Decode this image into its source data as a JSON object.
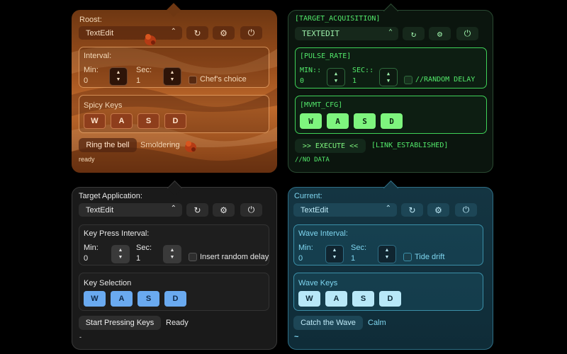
{
  "panels": {
    "roost": {
      "title": "Roost:",
      "app": "TextEdit",
      "interval_label": "Interval:",
      "min_label": "Min:",
      "min_value": "0",
      "sec_label": "Sec:",
      "sec_value": "1",
      "random_label": "Chef's choice",
      "keys_label": "Spicy Keys",
      "keys": [
        "W",
        "A",
        "S",
        "D"
      ],
      "start_label": "Ring the bell",
      "status": "Smoldering",
      "footer": "ready"
    },
    "terminal": {
      "title": "[TARGET_ACQUISITION]",
      "app": "TEXTEDIT",
      "interval_label": "[PULSE_RATE]",
      "min_label": "MIN::",
      "min_value": "0",
      "sec_label": "SEC::",
      "sec_value": "1",
      "random_label": "//RANDOM DELAY",
      "keys_label": "[MVMT_CFG]",
      "keys": [
        "W",
        "A",
        "S",
        "D"
      ],
      "start_label": ">> EXECUTE <<",
      "status": "[LINK_ESTABLISHED]",
      "footer": "//NO DATA"
    },
    "standard": {
      "title": "Target Application:",
      "app": "TextEdit",
      "interval_label": "Key Press Interval:",
      "min_label": "Min:",
      "min_value": "0",
      "sec_label": "Sec:",
      "sec_value": "1",
      "random_label": "Insert random delay",
      "keys_label": "Key Selection",
      "keys": [
        "W",
        "A",
        "S",
        "D"
      ],
      "start_label": "Start Pressing Keys",
      "status": "Ready",
      "footer": "-"
    },
    "ocean": {
      "title": "Current:",
      "app": "TextEdit",
      "interval_label": "Wave Interval:",
      "min_label": "Min:",
      "min_value": "0",
      "sec_label": "Sec:",
      "sec_value": "1",
      "random_label": "Tide drift",
      "keys_label": "Wave Keys",
      "keys": [
        "W",
        "A",
        "S",
        "D"
      ],
      "start_label": "Catch the Wave",
      "status": "Calm",
      "footer": "~"
    }
  },
  "icons": {
    "select": "chevron-up-down-icon",
    "refresh": "refresh-icon",
    "settings": "gear-icon",
    "power": "power-icon",
    "stepper": "stepper-arrows-icon",
    "decoration": "fire-creature-icon"
  },
  "colors": {
    "roost_accent": "#c06a2c",
    "terminal_accent": "#52e86a",
    "standard_key": "#6aaaf0",
    "ocean_accent": "#7fd6f0"
  }
}
